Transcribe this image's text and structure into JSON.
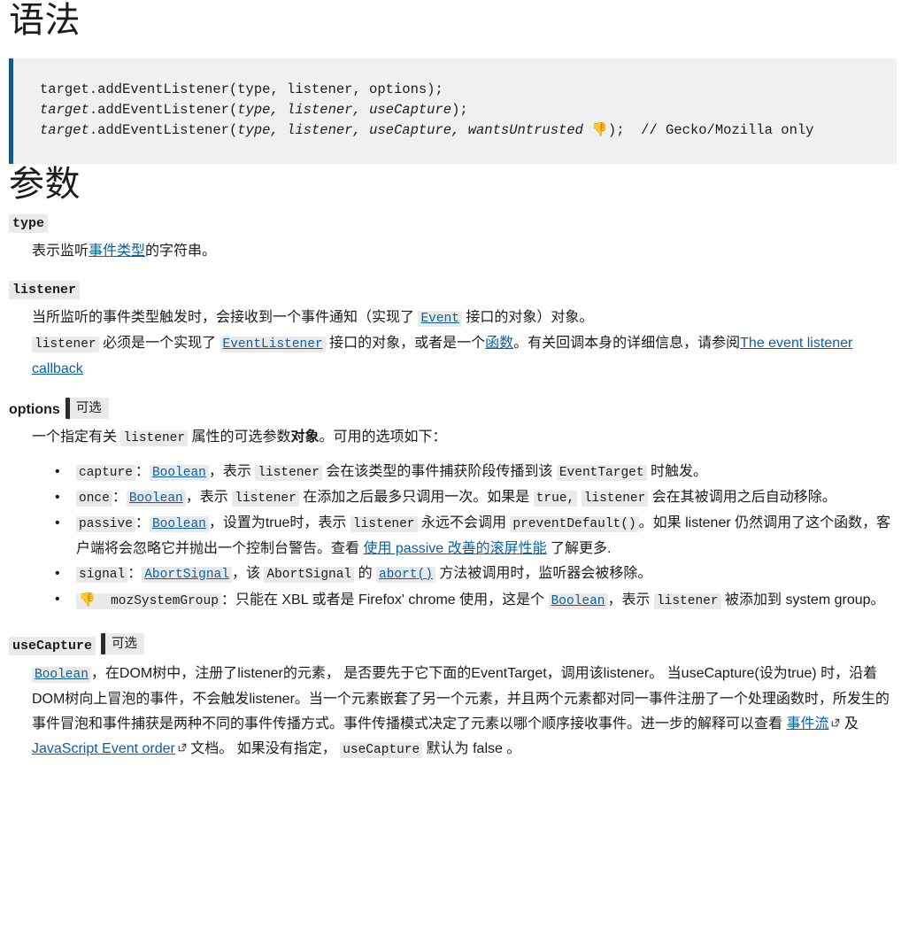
{
  "sections": {
    "syntax_heading": "语法",
    "params_heading": "参数"
  },
  "code_block": {
    "line1": "target.addEventListener(type, listener, options);",
    "line2_prefix": "target",
    "line2_rest": ".addEventListener(",
    "line2_args": "type, listener, useCapture",
    "line2_suffix": ");",
    "line3_args": "type, listener, useCapture, wantsUntrusted",
    "line3_emoji": "👎",
    "line3_suffix": ");",
    "line3_comment": "// Gecko/Mozilla only",
    "border_color": "#14578f",
    "background_color": "#f0f0f0"
  },
  "params": {
    "type": {
      "term": "type",
      "desc_before": "表示监听",
      "link_text": "事件类型",
      "desc_after": "的字符串。"
    },
    "listener": {
      "term": "listener",
      "p1_a": "当所监听的事件类型触发时，会接收到一个事件通知（实现了 ",
      "p1_link": "Event",
      "p1_b": " 接口的对象）对象。",
      "p2_code1": "listener",
      "p2_a": " 必须是一个实现了 ",
      "p2_link1": "EventListener",
      "p2_b": " 接口的对象，或者是一个",
      "p2_link2": "函数",
      "p2_c": "。有关回调本身的详细信息，请参阅",
      "p2_link3": "The event listener callback"
    },
    "options": {
      "term": "options",
      "badge": "可选",
      "desc_a": "一个指定有关 ",
      "desc_code": "listener",
      "desc_b": " 属性的可选参数",
      "desc_bold": "对象",
      "desc_c": "。可用的选项如下：",
      "items": [
        {
          "code": "capture",
          "colon": "：",
          "link": "Boolean",
          "a": "，表示 ",
          "code2": "listener",
          "b": " 会在该类型的事件捕获阶段传播到该 ",
          "code3": "EventTarget",
          "c": " 时触发。"
        },
        {
          "code": "once",
          "colon": "：",
          "link": "Boolean",
          "a": "，表示 ",
          "code2": "listener",
          "b": " 在添加之后最多只调用一次。如果是 ",
          "code3": "true,",
          "c": " ",
          "code4": "listener",
          "d": " 会在其被调用之后自动移除。"
        },
        {
          "code": "passive",
          "colon": "：",
          "link": "Boolean",
          "a": "，设置为true时，表示 ",
          "code2": "listener",
          "b": " 永远不会调用 ",
          "code3": "preventDefault()",
          "c": "。如果 listener 仍然调用了这个函数，客户端将会忽略它并抛出一个控制台警告。查看 ",
          "link2": "使用 passive 改善的滚屏性能",
          "d": " 了解更多."
        },
        {
          "code": "signal",
          "colon": "：",
          "link": "AbortSignal",
          "a": "，该 ",
          "code2": "AbortSignal",
          "b": " 的 ",
          "link2": "abort()",
          "c": " 方法被调用时，监听器会被移除。"
        },
        {
          "emoji": "👎",
          "code": "mozSystemGroup",
          "colon": "：",
          "a": "只能在 XBL 或者是 Firefox' chrome 使用，这是个 ",
          "link": "Boolean",
          "b": "，表示 ",
          "code2": "listener",
          "c": " 被添加到 system group。"
        }
      ]
    },
    "useCapture": {
      "term": "useCapture",
      "badge": "可选",
      "link": "Boolean",
      "a": "，在DOM树中，注册了listener的元素， 是否要先于它下面的EventTarget，调用该listener。 当useCapture(设为true) 时，沿着DOM树向上冒泡的事件，不会触发listener。当一个元素嵌套了另一个元素，并且两个元素都对同一事件注册了一个处理函数时，所发生的事件冒泡和事件捕获是两种不同的事件传播方式。事件传播模式决定了元素以哪个顺序接收事件。进一步的解释可以查看 ",
      "link2": "事件流",
      "b": " 及 ",
      "link3": "JavaScript Event order",
      "c": " 文档。 如果没有指定， ",
      "code": "useCapture",
      "d": " 默认为 false 。"
    }
  },
  "icons": {
    "external_link": "external-link-icon",
    "thumbs_down": "thumbs-down-icon"
  },
  "colors": {
    "link": "#0b5fa5",
    "code_bg": "#eaeaea",
    "text": "#1b1b1b"
  }
}
